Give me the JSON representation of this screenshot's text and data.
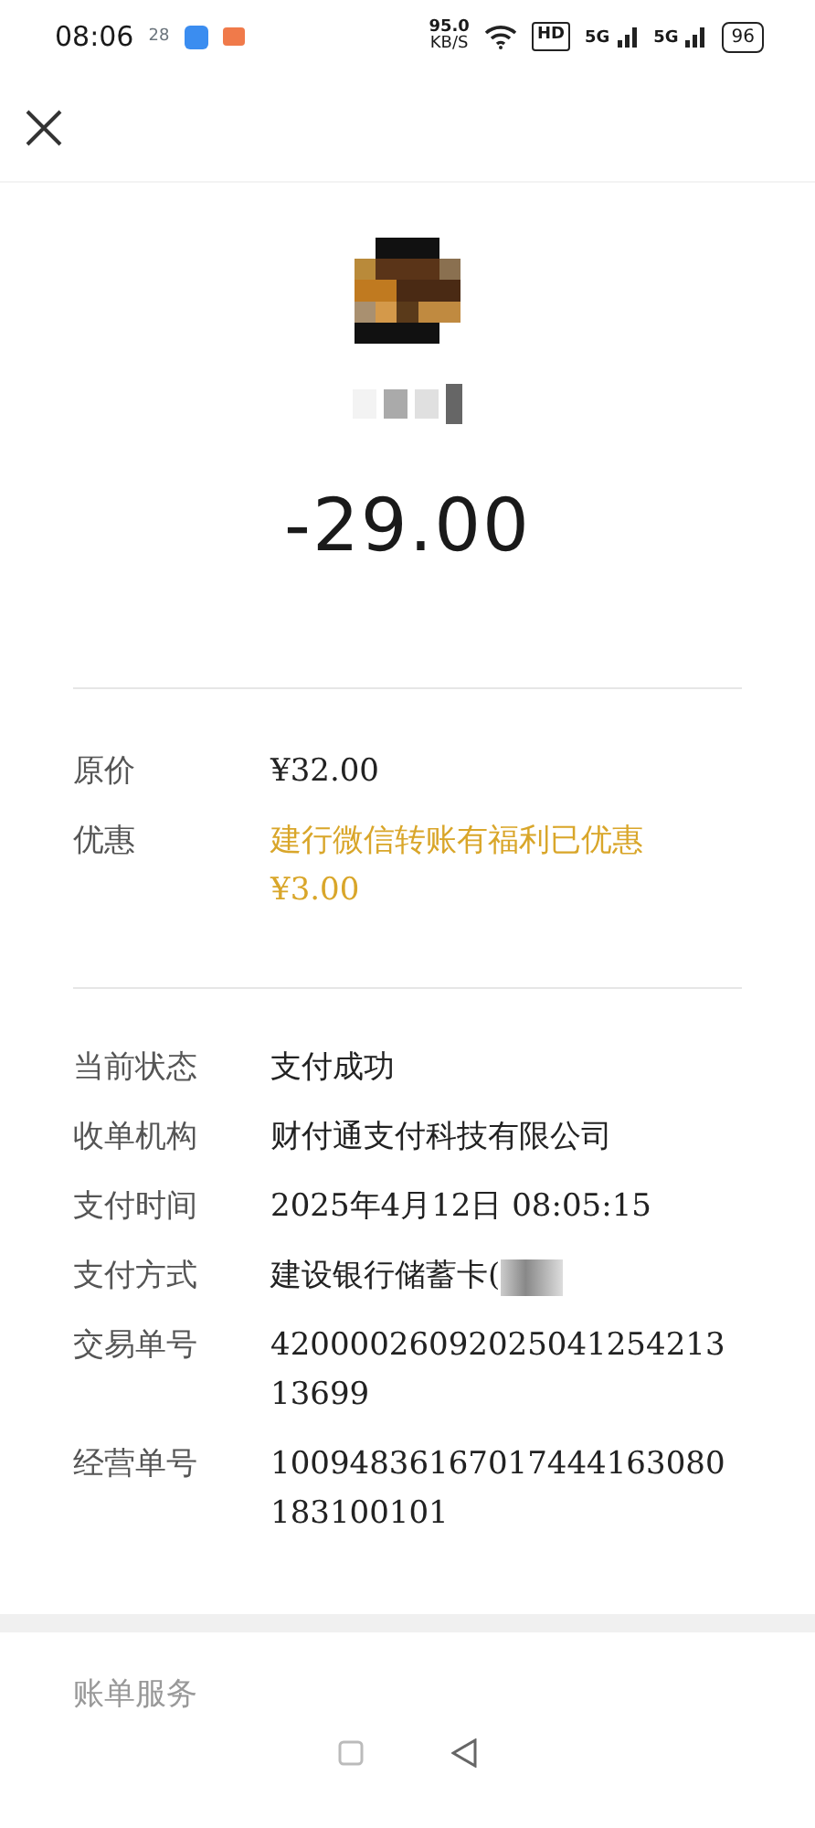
{
  "status_bar": {
    "time": "08:06",
    "calendar_day": "28",
    "net_speed": "95.0",
    "net_unit": "KB/S",
    "hd": "HD",
    "signal_1": "5G",
    "signal_2": "5G",
    "battery": "96"
  },
  "payment": {
    "amount": "-29.00"
  },
  "price_rows": [
    {
      "label": "原价",
      "value": "¥32.00",
      "kind": "plain"
    },
    {
      "label": "优惠",
      "value": "建行微信转账有福利已优惠",
      "extra": "¥3.00",
      "kind": "discount"
    }
  ],
  "detail_rows": [
    {
      "label": "当前状态",
      "value": "支付成功"
    },
    {
      "label": "收单机构",
      "value": "财付通支付科技有限公司"
    },
    {
      "label": "支付时间",
      "value": "2025年4月12日 08:05:15"
    },
    {
      "label": "支付方式",
      "value": "建设银行储蓄卡(",
      "masked": true
    },
    {
      "label": "交易单号",
      "value": "4200002609202504125421313699"
    },
    {
      "label": "经营单号",
      "value": "10094836167017444163080183100101"
    }
  ],
  "footer": {
    "section_title": "账单服务"
  }
}
